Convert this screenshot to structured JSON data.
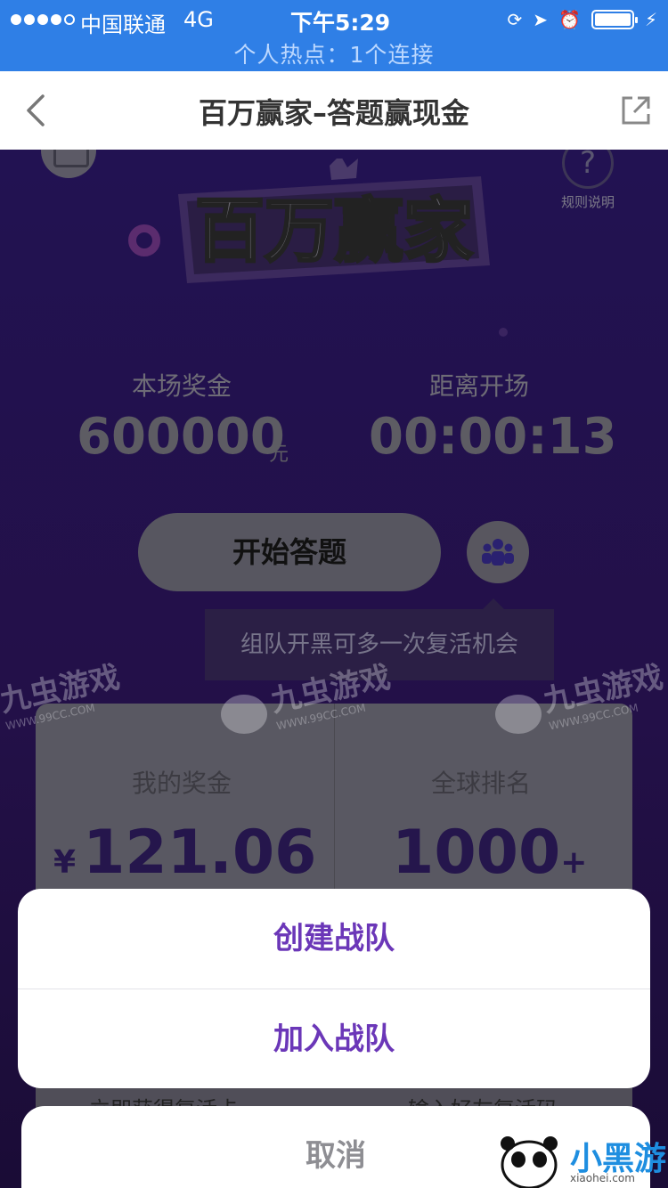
{
  "status_bar": {
    "carrier": "中国联通",
    "network": "4G",
    "time": "下午5:29",
    "hotspot": "个人热点：1个连接",
    "signal_dots_filled": 4,
    "signal_dots_total": 5
  },
  "nav": {
    "title": "百万赢家–答题赢现金",
    "back_icon": "chevron-left-icon",
    "share_icon": "share-icon"
  },
  "game": {
    "logo_text": "百万赢家",
    "rules_label": "规则说明",
    "rules_icon": "?",
    "prize_label": "本场奖金",
    "prize_value": "600000",
    "prize_unit": "元",
    "countdown_label": "距离开场",
    "countdown_value": "00:00:13",
    "start_button": "开始答题",
    "team_tip": "组队开黑可多一次复活机会",
    "my_bonus_label": "我的奖金",
    "my_bonus_currency": "¥",
    "my_bonus_value": "121.06",
    "rank_label": "全球排名",
    "rank_value": "1000",
    "rank_suffix": "+",
    "lower_left_text": "立即获得复活卡",
    "lower_right_text": "输入好友复活码"
  },
  "action_sheet": {
    "create_team": "创建战队",
    "join_team": "加入战队",
    "cancel": "取消"
  },
  "watermark": {
    "brand": "九虫游戏",
    "url": "WWW.99CC.COM"
  },
  "corner_logo": {
    "name": "小黑游戏",
    "url": "xiaohei.com"
  },
  "colors": {
    "status_bar": "#2f7fe6",
    "sheet_text": "#6b37b8",
    "cancel_text": "#8e8e93"
  }
}
